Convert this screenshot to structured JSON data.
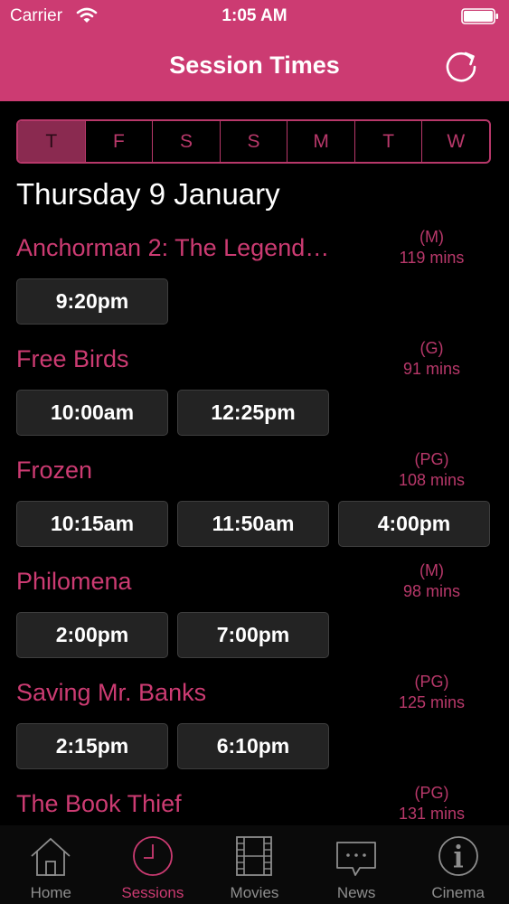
{
  "status_bar": {
    "carrier": "Carrier",
    "time": "1:05 AM"
  },
  "nav": {
    "title": "Session Times",
    "refresh_icon": "refresh-icon"
  },
  "day_tabs": [
    {
      "label": "T",
      "active": true
    },
    {
      "label": "F",
      "active": false
    },
    {
      "label": "S",
      "active": false
    },
    {
      "label": "S",
      "active": false
    },
    {
      "label": "M",
      "active": false
    },
    {
      "label": "T",
      "active": false
    },
    {
      "label": "W",
      "active": false
    }
  ],
  "date_heading": "Thursday 9 January",
  "movies": [
    {
      "title": "Anchorman 2: The Legend…",
      "rating": "(M)",
      "duration": "119 mins",
      "times": [
        "9:20pm"
      ]
    },
    {
      "title": "Free Birds",
      "rating": "(G)",
      "duration": "91 mins",
      "times": [
        "10:00am",
        "12:25pm"
      ]
    },
    {
      "title": "Frozen",
      "rating": "(PG)",
      "duration": "108 mins",
      "times": [
        "10:15am",
        "11:50am",
        "4:00pm"
      ]
    },
    {
      "title": "Philomena",
      "rating": "(M)",
      "duration": "98 mins",
      "times": [
        "2:00pm",
        "7:00pm"
      ]
    },
    {
      "title": "Saving Mr. Banks",
      "rating": "(PG)",
      "duration": "125 mins",
      "times": [
        "2:15pm",
        "6:10pm"
      ]
    },
    {
      "title": "The Book Thief",
      "rating": "(PG)",
      "duration": "131 mins",
      "times": []
    }
  ],
  "tab_bar": [
    {
      "label": "Home",
      "icon": "home-icon",
      "active": false
    },
    {
      "label": "Sessions",
      "icon": "clock-icon",
      "active": true
    },
    {
      "label": "Movies",
      "icon": "film-icon",
      "active": false
    },
    {
      "label": "News",
      "icon": "chat-bubble-icon",
      "active": false
    },
    {
      "label": "Cinema",
      "icon": "info-icon",
      "active": false
    }
  ],
  "colors": {
    "accent": "#cc3b72",
    "tab_inactive": "#8e8e8e",
    "background": "#000000"
  }
}
